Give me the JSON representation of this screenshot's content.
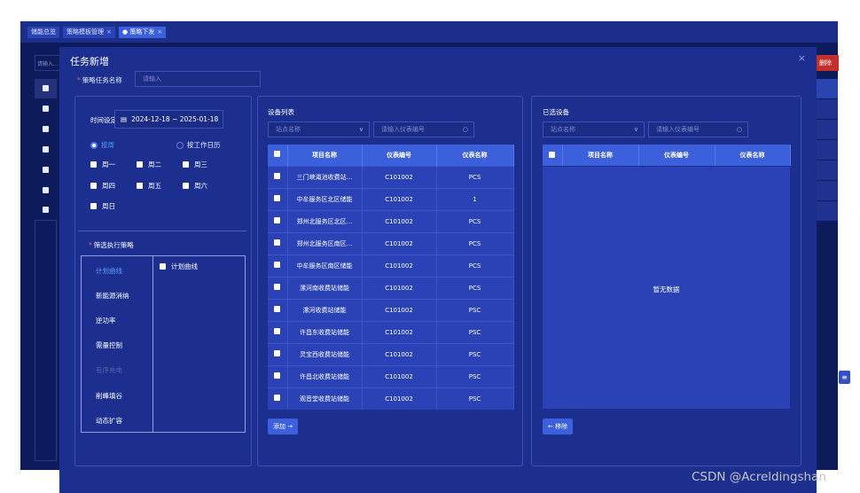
{
  "tabs": [
    {
      "label": "储能总览"
    },
    {
      "label": "策略模板管理",
      "close": "×"
    },
    {
      "label": "● 策略下发",
      "close": "×"
    }
  ],
  "background": {
    "search_placeholder": "请输入...",
    "delete_label": "删除",
    "filter_icon": "≡"
  },
  "dialog": {
    "title": "任务新增",
    "close": "×",
    "task_name": {
      "required": "*",
      "label": "策略任务名称",
      "placeholder": "请输入"
    }
  },
  "left_panel": {
    "time_label": "时间设定",
    "calendar_icon": "▤",
    "date_range": "2024-12-18 ~ 2025-01-18",
    "radio_week": "按周",
    "radio_workday": "按工作日历",
    "days": [
      "周一",
      "周二",
      "周三",
      "周四",
      "周五",
      "周六",
      "周日"
    ],
    "filter_label": "筛选执行策略",
    "filter_required": "*",
    "strategies": [
      "计划曲线",
      "新能源消纳",
      "逆功率",
      "需量控制",
      "有序充电",
      "削峰填谷",
      "动态扩容"
    ],
    "plan_checkbox_label": "计划曲线"
  },
  "device_panel": {
    "title": "设备列表",
    "site_placeholder": "站点名称",
    "meter_placeholder": "请输入仪表编号",
    "search_icon": "○",
    "caret": "∨",
    "columns": [
      "项目名称",
      "仪表编号",
      "仪表名称"
    ],
    "rows": [
      [
        "三门峡渑池收费站...",
        "C101002",
        "PCS"
      ],
      [
        "中牟服务区北区储能",
        "C101002",
        "1"
      ],
      [
        "郑州北服务区北区...",
        "C101002",
        "PCS"
      ],
      [
        "郑州北服务区南区...",
        "C101002",
        "PCS"
      ],
      [
        "中牟服务区南区储能",
        "C101002",
        "PCS"
      ],
      [
        "漯河南收费站储能",
        "C101002",
        "PCS"
      ],
      [
        "漯河收费站储能",
        "C101002",
        "PSC"
      ],
      [
        "许昌东收费站储能",
        "C101002",
        "PSC"
      ],
      [
        "灵宝西收费站储能",
        "C101002",
        "PSC"
      ],
      [
        "许昌北收费站储能",
        "C101002",
        "PSC"
      ],
      [
        "观音堂收费站储能",
        "C101002",
        "PSC"
      ]
    ],
    "add_button": "添加 →"
  },
  "selected_panel": {
    "title": "已选设备",
    "site_placeholder": "站点名称",
    "meter_placeholder": "请输入仪表编号",
    "search_icon": "○",
    "caret": "∨",
    "columns": [
      "项目名称",
      "仪表编号",
      "仪表名称"
    ],
    "empty_text": "暂无数据",
    "remove_button": "← 移除"
  },
  "watermark": "CSDN @Acreldingshan",
  "colors": {
    "page_bg": "#0d1a5c",
    "dialog_bg": "#1c2f8f",
    "accent": "#3c60dc",
    "delete": "#c3302a"
  }
}
